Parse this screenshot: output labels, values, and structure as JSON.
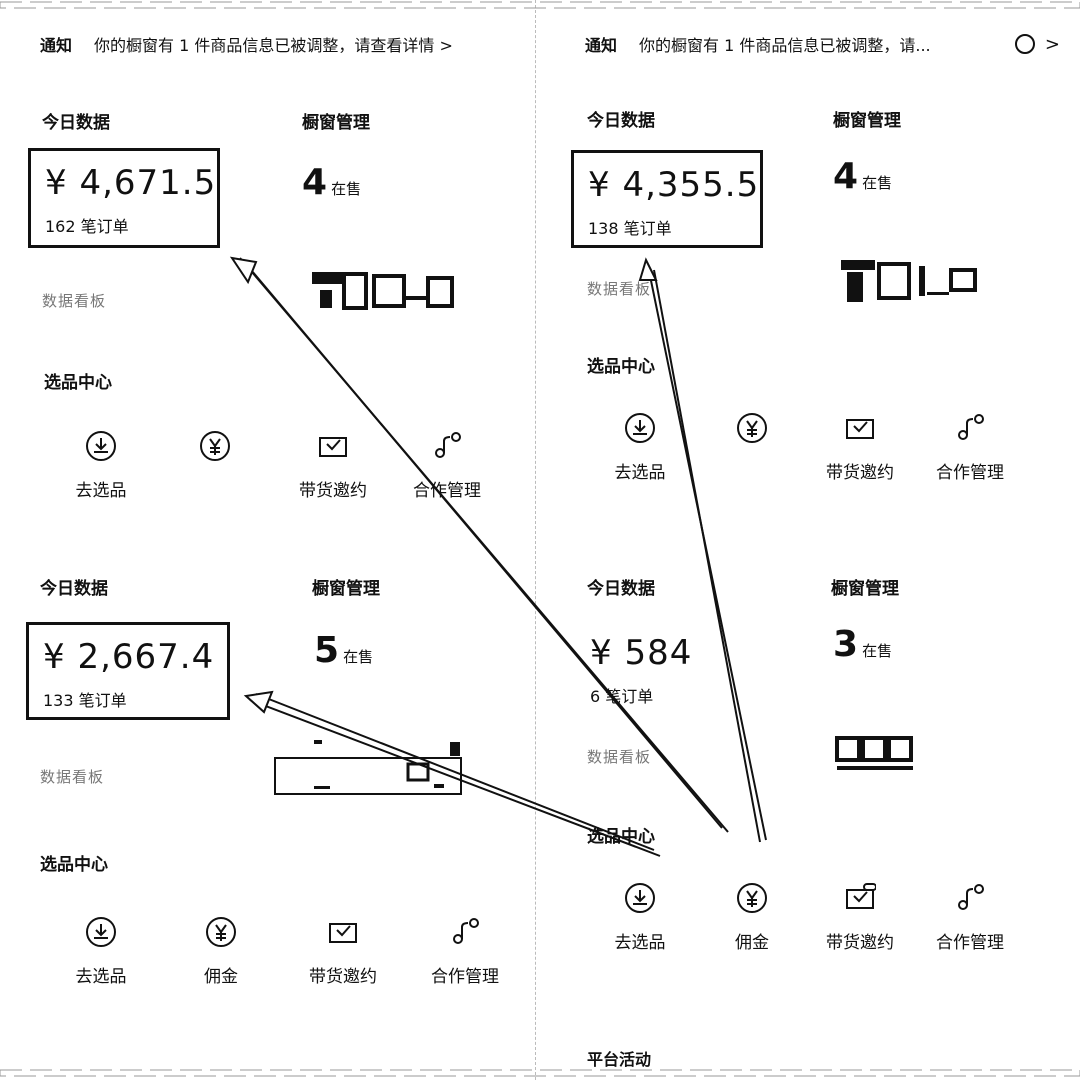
{
  "left": {
    "notice": {
      "tag": "通知",
      "message": "你的橱窗有 1 件商品信息已被调整，请查看详情 >"
    },
    "blocks": [
      {
        "today_title": "今日数据",
        "amount": "¥ 4,671.5",
        "orders": "162 笔订单",
        "window_title": "橱窗管理",
        "window_count": "4",
        "window_label": "在售",
        "data_link": "数据看板",
        "select_title": "选品中心",
        "tools": [
          "去选品",
          "",
          "带货邀约",
          "合作管理"
        ]
      },
      {
        "today_title": "今日数据",
        "amount": "¥ 2,667.4",
        "orders": "133 笔订单",
        "window_title": "橱窗管理",
        "window_count": "5",
        "window_label": "在售",
        "data_link": "数据看板",
        "select_title": "选品中心",
        "tools": [
          "去选品",
          "佣金",
          "带货邀约",
          "合作管理"
        ]
      }
    ]
  },
  "right": {
    "notice": {
      "tag": "通知",
      "message": "你的橱窗有 1 件商品信息已被调整，请...",
      "chevron": ">"
    },
    "blocks": [
      {
        "today_title": "今日数据",
        "amount": "¥ 4,355.5",
        "orders": "138 笔订单",
        "window_title": "橱窗管理",
        "window_count": "4",
        "window_label": "在售",
        "data_link": "数据看板",
        "select_title": "选品中心",
        "tools": [
          "去选品",
          "",
          "带货邀约",
          "合作管理"
        ]
      },
      {
        "today_title": "今日数据",
        "amount": "¥ 584",
        "orders": "6 笔订单",
        "window_title": "橱窗管理",
        "window_count": "3",
        "window_label": "在售",
        "data_link": "数据看板",
        "select_title": "选品中心",
        "tools": [
          "去选品",
          "佣金",
          "带货邀约",
          "合作管理"
        ]
      }
    ],
    "platform_title": "平台活动"
  },
  "icons": [
    "download-circle-icon",
    "yen-circle-icon",
    "envelope-check-icon",
    "handshake-link-icon"
  ],
  "colors": {
    "ink": "#111111",
    "muted": "#777777",
    "background": "#ffffff"
  }
}
